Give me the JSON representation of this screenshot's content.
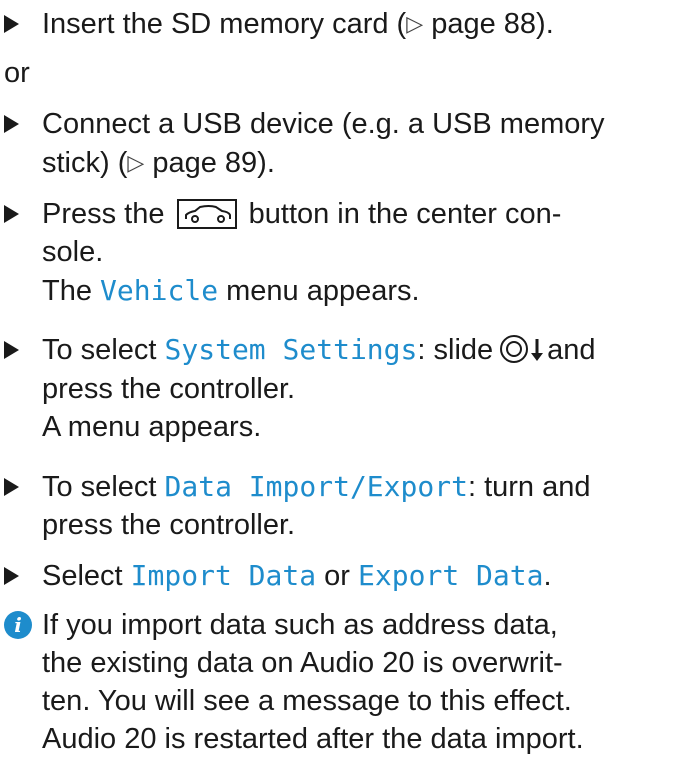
{
  "steps": {
    "s1": "Insert the SD memory card (",
    "s1_ref": "page 88).",
    "or": "or",
    "s2_l1": "Connect a USB device (e.g. a USB memory",
    "s2_l2a": "stick) (",
    "s2_ref": "page 89).",
    "s3_pre": "Press the",
    "s3_post": "button in the center con-",
    "s3_l2": "sole.",
    "s3_r_pre": "The",
    "s3_r_code": "Vehicle",
    "s3_r_post": "menu appears.",
    "s4_pre": "To select",
    "s4_code": "System Settings",
    "s4_mid": ": slide",
    "s4_post": "and",
    "s4_l2": "press the controller.",
    "s4_result": "A menu appears.",
    "s5_pre": "To select",
    "s5_code": "Data Import/Export",
    "s5_post": ": turn and",
    "s5_l2": "press the controller.",
    "s6_pre": "Select",
    "s6_code1": "Import Data",
    "s6_mid": "or",
    "s6_code2": "Export Data",
    "s6_end": "."
  },
  "info": {
    "l1": "If you import data such as address data,",
    "l2": "the existing data on Audio 20 is overwrit-",
    "l3": "ten. You will see a message to this effect.",
    "l4": "Audio 20 is restarted after the data import."
  },
  "icons": {
    "bullet": "right-triangle-bullet",
    "ref": "hollow-right-triangle",
    "car": "vehicle-button-icon",
    "controller": "controller-slide-down-icon",
    "info": "info-icon"
  },
  "colors": {
    "text": "#1a1a1a",
    "accent": "#1e8ccc"
  }
}
